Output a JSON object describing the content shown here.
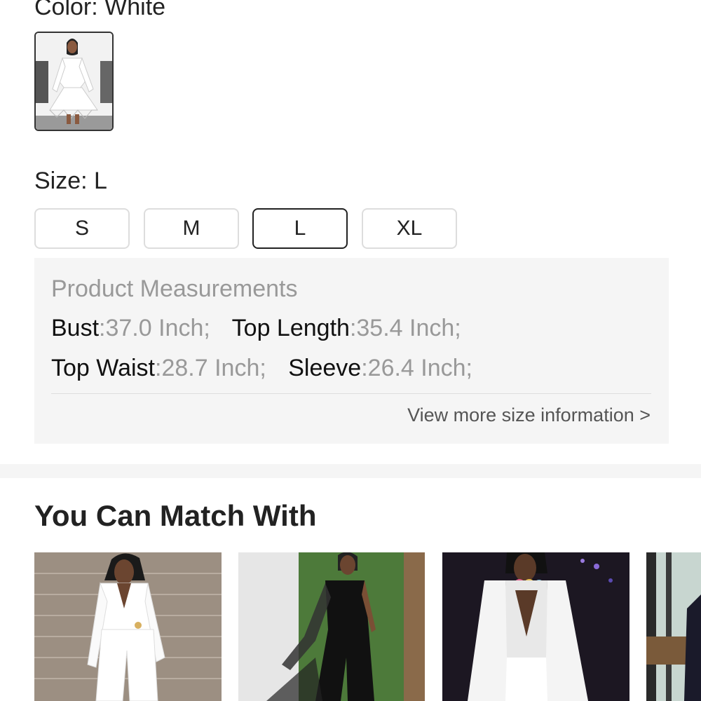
{
  "color": {
    "label": "Color: White"
  },
  "size": {
    "label": "Size: L",
    "options": [
      "S",
      "M",
      "L",
      "XL"
    ],
    "selected": "L"
  },
  "measurements": {
    "title": "Product Measurements",
    "items": [
      {
        "key": "Bust",
        "value": ":37.0 Inch;"
      },
      {
        "key": "Top Length",
        "value": ":35.4 Inch;"
      },
      {
        "key": "Top Waist",
        "value": ":28.7 Inch;"
      },
      {
        "key": "Sleeve",
        "value": ":26.4 Inch;"
      }
    ],
    "more_link": "View more size information >"
  },
  "match": {
    "title": "You Can Match With"
  },
  "colors": {
    "selected_border": "#222222",
    "option_border": "#dddddd",
    "panel_bg": "#f5f5f5",
    "muted_text": "#999999"
  }
}
